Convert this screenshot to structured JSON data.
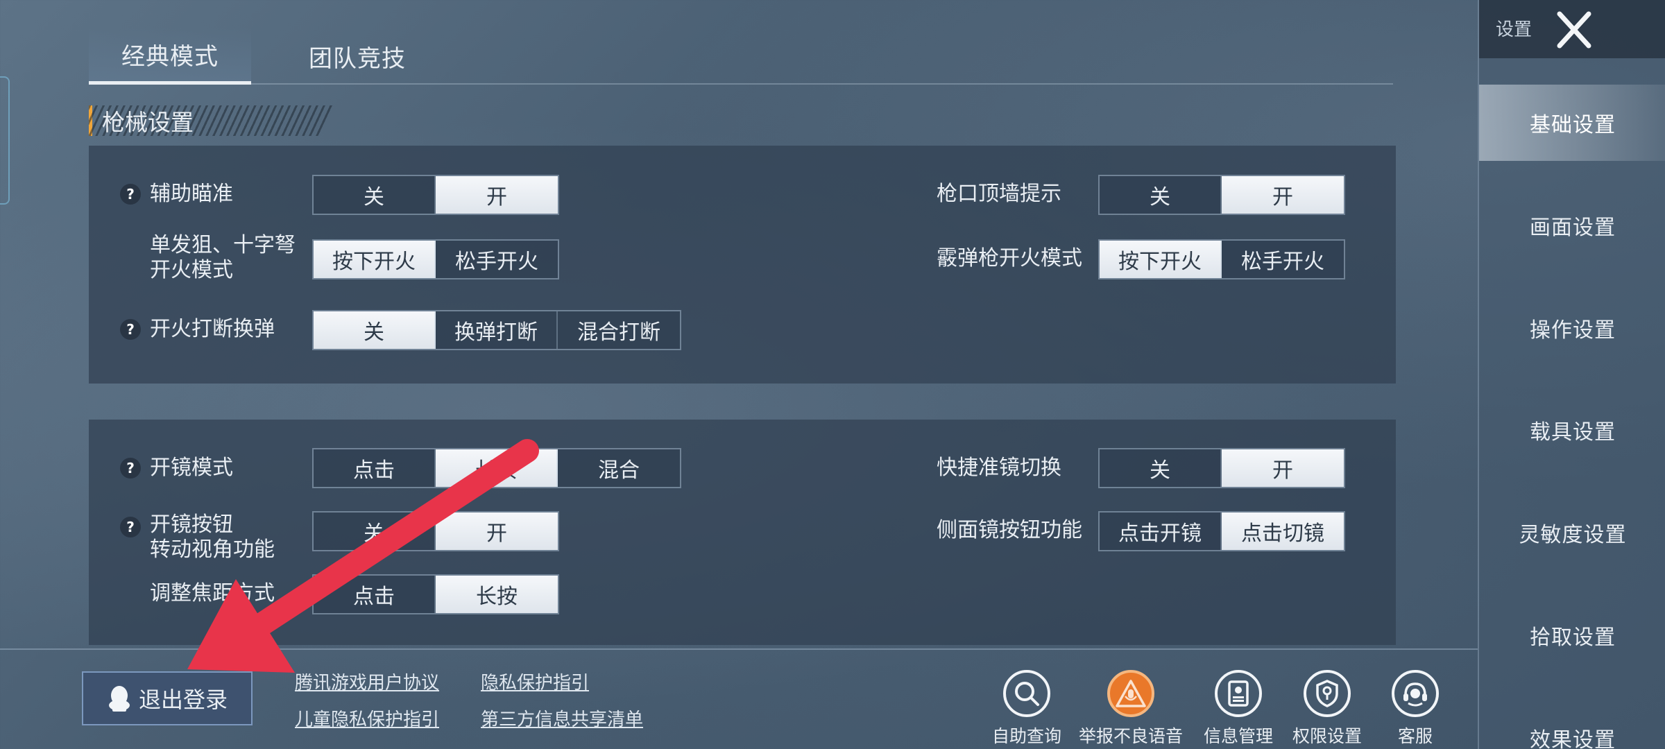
{
  "tabs": [
    "经典模式",
    "团队竞技"
  ],
  "section_title": "枪械设置",
  "panel1": {
    "aim_assist": {
      "label": "辅助瞄准",
      "options": [
        "关",
        "开"
      ],
      "selected": 1
    },
    "single_fire": {
      "label_line1": "单发狙、十字弩",
      "label_line2": "开火模式",
      "options": [
        "按下开火",
        "松手开火"
      ],
      "selected": 0
    },
    "fire_interrupt": {
      "label": "开火打断换弹",
      "options": [
        "关",
        "换弹打断",
        "混合打断"
      ],
      "selected": 0
    },
    "muzzle_wall": {
      "label": "枪口顶墙提示",
      "options": [
        "关",
        "开"
      ],
      "selected": 1
    },
    "shotgun_fire": {
      "label": "霰弹枪开火模式",
      "options": [
        "按下开火",
        "松手开火"
      ],
      "selected": 0
    }
  },
  "panel2": {
    "scope_mode": {
      "label": "开镜模式",
      "options": [
        "点击",
        "长按",
        "混合"
      ],
      "selected": 1
    },
    "scope_button": {
      "label_line1": "开镜按钮",
      "label_line2": "转动视角功能",
      "options": [
        "关",
        "开"
      ],
      "selected": 1
    },
    "focus_adjust": {
      "label": "调整焦距方式",
      "options": [
        "点击",
        "长按"
      ],
      "selected": 1
    },
    "quick_scope": {
      "label": "快捷准镜切换",
      "options": [
        "关",
        "开"
      ],
      "selected": 1
    },
    "side_scope": {
      "label": "侧面镜按钮功能",
      "options": [
        "点击开镜",
        "点击切镜"
      ],
      "selected": 1
    }
  },
  "sidebar": {
    "title": "设置",
    "items": [
      "基础设置",
      "画面设置",
      "操作设置",
      "载具设置",
      "灵敏度设置",
      "拾取设置",
      "效果设置"
    ],
    "active": 0
  },
  "bottom": {
    "logout": "退出登录",
    "links": [
      "腾讯游戏用户协议",
      "隐私保护指引",
      "儿童隐私保护指引",
      "第三方信息共享清单"
    ],
    "utilities": [
      "自助查询",
      "举报不良语音",
      "信息管理",
      "权限设置",
      "客服"
    ]
  },
  "colors": {
    "accent": "#f0a63a",
    "selected_bg": "#f2f5f8",
    "annotation_arrow": "#e8344a",
    "report_icon": "#e9782a"
  }
}
